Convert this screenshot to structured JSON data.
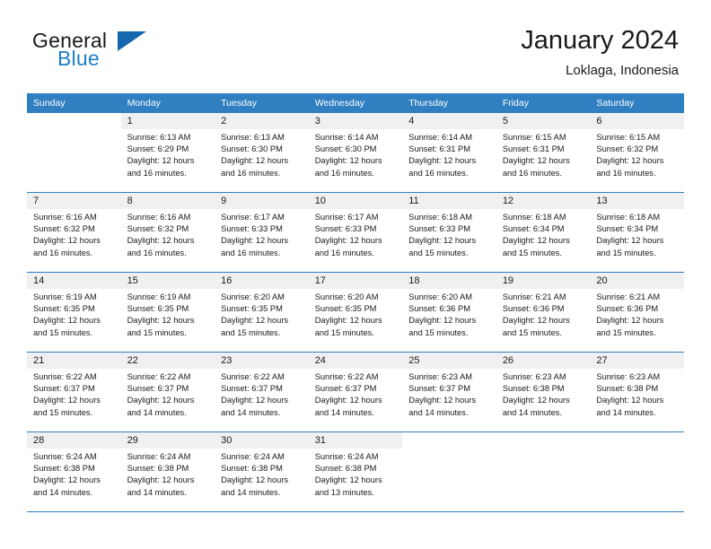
{
  "brand": {
    "name_top": "General",
    "name_bottom": "Blue",
    "accent_color": "#1668ad",
    "text_color": "#1a1a1a"
  },
  "header": {
    "title": "January 2024",
    "location": "Loklaga, Indonesia"
  },
  "theme": {
    "header_blue": "#2f7fc1",
    "row_band_gray": "#f0f0f0",
    "page_background": "#ffffff"
  },
  "calendar": {
    "weekdays": [
      "Sunday",
      "Monday",
      "Tuesday",
      "Wednesday",
      "Thursday",
      "Friday",
      "Saturday"
    ],
    "labels": {
      "sunrise": "Sunrise:",
      "sunset": "Sunset:",
      "daylight": "Daylight:"
    },
    "weeks": [
      [
        {
          "day": "",
          "empty": true
        },
        {
          "day": "1",
          "sunrise": "Sunrise: 6:13 AM",
          "sunset": "Sunset: 6:29 PM",
          "daylight": "Daylight: 12 hours and 16 minutes."
        },
        {
          "day": "2",
          "sunrise": "Sunrise: 6:13 AM",
          "sunset": "Sunset: 6:30 PM",
          "daylight": "Daylight: 12 hours and 16 minutes."
        },
        {
          "day": "3",
          "sunrise": "Sunrise: 6:14 AM",
          "sunset": "Sunset: 6:30 PM",
          "daylight": "Daylight: 12 hours and 16 minutes."
        },
        {
          "day": "4",
          "sunrise": "Sunrise: 6:14 AM",
          "sunset": "Sunset: 6:31 PM",
          "daylight": "Daylight: 12 hours and 16 minutes."
        },
        {
          "day": "5",
          "sunrise": "Sunrise: 6:15 AM",
          "sunset": "Sunset: 6:31 PM",
          "daylight": "Daylight: 12 hours and 16 minutes."
        },
        {
          "day": "6",
          "sunrise": "Sunrise: 6:15 AM",
          "sunset": "Sunset: 6:32 PM",
          "daylight": "Daylight: 12 hours and 16 minutes."
        }
      ],
      [
        {
          "day": "7",
          "sunrise": "Sunrise: 6:16 AM",
          "sunset": "Sunset: 6:32 PM",
          "daylight": "Daylight: 12 hours and 16 minutes."
        },
        {
          "day": "8",
          "sunrise": "Sunrise: 6:16 AM",
          "sunset": "Sunset: 6:32 PM",
          "daylight": "Daylight: 12 hours and 16 minutes."
        },
        {
          "day": "9",
          "sunrise": "Sunrise: 6:17 AM",
          "sunset": "Sunset: 6:33 PM",
          "daylight": "Daylight: 12 hours and 16 minutes."
        },
        {
          "day": "10",
          "sunrise": "Sunrise: 6:17 AM",
          "sunset": "Sunset: 6:33 PM",
          "daylight": "Daylight: 12 hours and 16 minutes."
        },
        {
          "day": "11",
          "sunrise": "Sunrise: 6:18 AM",
          "sunset": "Sunset: 6:33 PM",
          "daylight": "Daylight: 12 hours and 15 minutes."
        },
        {
          "day": "12",
          "sunrise": "Sunrise: 6:18 AM",
          "sunset": "Sunset: 6:34 PM",
          "daylight": "Daylight: 12 hours and 15 minutes."
        },
        {
          "day": "13",
          "sunrise": "Sunrise: 6:18 AM",
          "sunset": "Sunset: 6:34 PM",
          "daylight": "Daylight: 12 hours and 15 minutes."
        }
      ],
      [
        {
          "day": "14",
          "sunrise": "Sunrise: 6:19 AM",
          "sunset": "Sunset: 6:35 PM",
          "daylight": "Daylight: 12 hours and 15 minutes."
        },
        {
          "day": "15",
          "sunrise": "Sunrise: 6:19 AM",
          "sunset": "Sunset: 6:35 PM",
          "daylight": "Daylight: 12 hours and 15 minutes."
        },
        {
          "day": "16",
          "sunrise": "Sunrise: 6:20 AM",
          "sunset": "Sunset: 6:35 PM",
          "daylight": "Daylight: 12 hours and 15 minutes."
        },
        {
          "day": "17",
          "sunrise": "Sunrise: 6:20 AM",
          "sunset": "Sunset: 6:35 PM",
          "daylight": "Daylight: 12 hours and 15 minutes."
        },
        {
          "day": "18",
          "sunrise": "Sunrise: 6:20 AM",
          "sunset": "Sunset: 6:36 PM",
          "daylight": "Daylight: 12 hours and 15 minutes."
        },
        {
          "day": "19",
          "sunrise": "Sunrise: 6:21 AM",
          "sunset": "Sunset: 6:36 PM",
          "daylight": "Daylight: 12 hours and 15 minutes."
        },
        {
          "day": "20",
          "sunrise": "Sunrise: 6:21 AM",
          "sunset": "Sunset: 6:36 PM",
          "daylight": "Daylight: 12 hours and 15 minutes."
        }
      ],
      [
        {
          "day": "21",
          "sunrise": "Sunrise: 6:22 AM",
          "sunset": "Sunset: 6:37 PM",
          "daylight": "Daylight: 12 hours and 15 minutes."
        },
        {
          "day": "22",
          "sunrise": "Sunrise: 6:22 AM",
          "sunset": "Sunset: 6:37 PM",
          "daylight": "Daylight: 12 hours and 14 minutes."
        },
        {
          "day": "23",
          "sunrise": "Sunrise: 6:22 AM",
          "sunset": "Sunset: 6:37 PM",
          "daylight": "Daylight: 12 hours and 14 minutes."
        },
        {
          "day": "24",
          "sunrise": "Sunrise: 6:22 AM",
          "sunset": "Sunset: 6:37 PM",
          "daylight": "Daylight: 12 hours and 14 minutes."
        },
        {
          "day": "25",
          "sunrise": "Sunrise: 6:23 AM",
          "sunset": "Sunset: 6:37 PM",
          "daylight": "Daylight: 12 hours and 14 minutes."
        },
        {
          "day": "26",
          "sunrise": "Sunrise: 6:23 AM",
          "sunset": "Sunset: 6:38 PM",
          "daylight": "Daylight: 12 hours and 14 minutes."
        },
        {
          "day": "27",
          "sunrise": "Sunrise: 6:23 AM",
          "sunset": "Sunset: 6:38 PM",
          "daylight": "Daylight: 12 hours and 14 minutes."
        }
      ],
      [
        {
          "day": "28",
          "sunrise": "Sunrise: 6:24 AM",
          "sunset": "Sunset: 6:38 PM",
          "daylight": "Daylight: 12 hours and 14 minutes."
        },
        {
          "day": "29",
          "sunrise": "Sunrise: 6:24 AM",
          "sunset": "Sunset: 6:38 PM",
          "daylight": "Daylight: 12 hours and 14 minutes."
        },
        {
          "day": "30",
          "sunrise": "Sunrise: 6:24 AM",
          "sunset": "Sunset: 6:38 PM",
          "daylight": "Daylight: 12 hours and 14 minutes."
        },
        {
          "day": "31",
          "sunrise": "Sunrise: 6:24 AM",
          "sunset": "Sunset: 6:38 PM",
          "daylight": "Daylight: 12 hours and 13 minutes."
        },
        {
          "day": "",
          "empty": true
        },
        {
          "day": "",
          "empty": true
        },
        {
          "day": "",
          "empty": true
        }
      ]
    ]
  }
}
